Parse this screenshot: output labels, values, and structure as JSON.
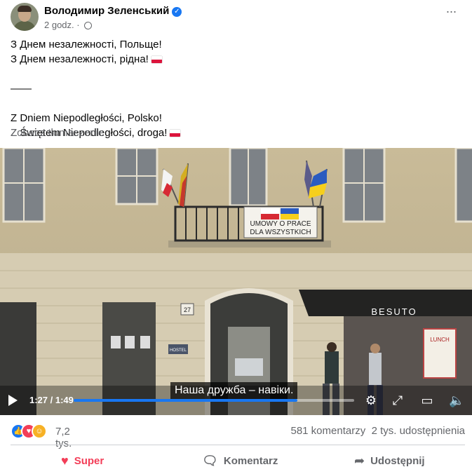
{
  "post": {
    "author": "Володимир Зеленський",
    "time": "2 godz.",
    "lines": [
      "З Днем незалежності, Польще!",
      "З Днем незалежності, рідна!",
      "",
      "——",
      "",
      "Z Dniem Niepodległości, Polsko!",
      "Z Świętem Niepodległości, droga!"
    ],
    "flag_lines": [
      1,
      6
    ],
    "translate_link": "Zobacz tłumaczenie"
  },
  "video": {
    "subtitle": "Наша дружба – навіки.",
    "time_display": "1:27 / 1:49",
    "progress_fraction": 0.798,
    "scene": {
      "banner_text": [
        "UMOWY O PRACE",
        "DLA WSZYSTKICH"
      ],
      "shop_sign": "BESUTO",
      "house_number": "27",
      "hostel_sign": "HOSTEL",
      "menu_board": "LUNCH"
    }
  },
  "engagement": {
    "reactions_count": "7,2 tys.",
    "comments": "581 komentarzy",
    "shares": "2 tys. udostępnienia"
  },
  "actions": {
    "react": "Super",
    "comment": "Komentarz",
    "share": "Udostępnij"
  },
  "colors": {
    "accent": "#1877f2",
    "love": "#f33e58",
    "muted": "#65676b"
  }
}
